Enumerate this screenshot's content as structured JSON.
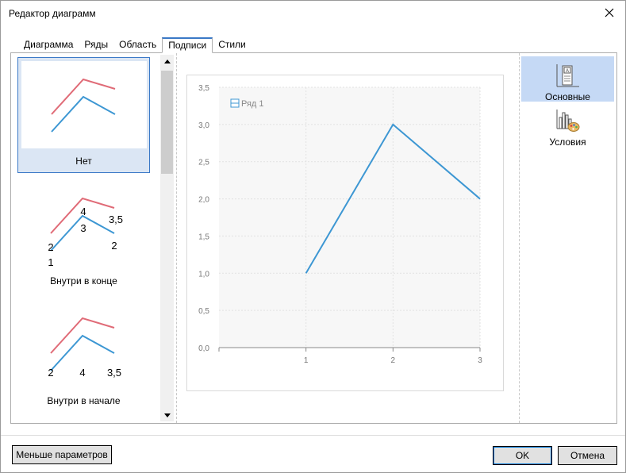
{
  "window": {
    "title": "Редактор диаграмм"
  },
  "tabs": [
    {
      "label": "Диаграмма"
    },
    {
      "label": "Ряды"
    },
    {
      "label": "Область"
    },
    {
      "label": "Подписи",
      "active": true
    },
    {
      "label": "Стили"
    }
  ],
  "label_options": [
    {
      "label": "Нет",
      "selected": true
    },
    {
      "label": "Внутри в конце",
      "value_labels": [
        "4",
        "3,5",
        "3",
        "2",
        "2",
        "1"
      ]
    },
    {
      "label": "Внутри в начале",
      "value_labels": [
        "2",
        "4",
        "3,5"
      ]
    }
  ],
  "right_panel": [
    {
      "label": "Основные",
      "icon": "label-basic-icon",
      "selected": true
    },
    {
      "label": "Условия",
      "icon": "conditions-icon"
    }
  ],
  "chart_data": {
    "type": "line",
    "x": [
      1,
      2,
      3
    ],
    "series": [
      {
        "name": "Ряд 1",
        "values": [
          1.0,
          3.0,
          2.0
        ],
        "color": "#3d97d3"
      }
    ],
    "ylim": [
      0,
      3.5
    ],
    "y_ticks": [
      "0,0",
      "0,5",
      "1,0",
      "1,5",
      "2,0",
      "2,5",
      "3,0",
      "3,5"
    ],
    "x_ticks": [
      "1",
      "2",
      "3"
    ],
    "legend": "top-left",
    "grid": true,
    "background": "#f7f7f7"
  },
  "buttons": {
    "fewer_params": "Меньше параметров",
    "ok": "OK",
    "cancel": "Отмена"
  },
  "colors": {
    "accent": "#3b79c7",
    "series_red": "#e06b77",
    "series_blue": "#3d97d3"
  }
}
